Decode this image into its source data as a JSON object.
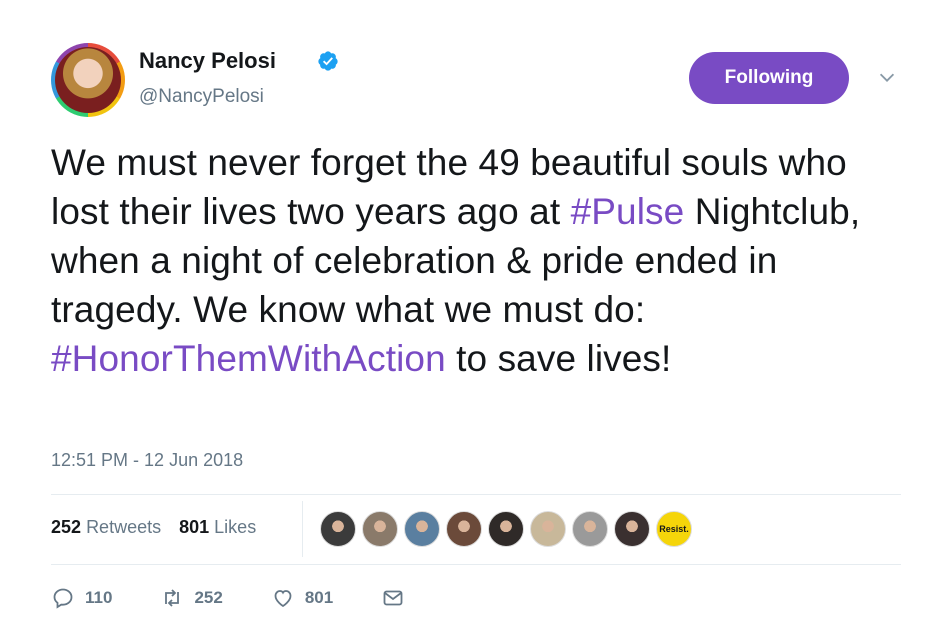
{
  "author": {
    "name": "Nancy Pelosi",
    "handle": "@NancyPelosi",
    "verified": true
  },
  "follow_button": {
    "label": "Following",
    "color": "#794bc4"
  },
  "tweet": {
    "segments": [
      {
        "text": "We must never forget the 49 beautiful souls who lost their lives two years ago at ",
        "tag": false
      },
      {
        "text": "#Pulse",
        "tag": true
      },
      {
        "text": " Nightclub, when a night of celebration & pride ended in tragedy. We know what we must do: ",
        "tag": false
      },
      {
        "text": "#HonorThemWithAction",
        "tag": true
      },
      {
        "text": " to save lives!",
        "tag": false
      }
    ],
    "timestamp": "12:51 PM - 12 Jun 2018"
  },
  "stats": {
    "retweets_count": "252",
    "retweets_label": "Retweets",
    "likes_count": "801",
    "likes_label": "Likes"
  },
  "likers": {
    "avatar_colors": [
      "#3b3b3b",
      "#8a7a6a",
      "#5a7fa0",
      "#6b4a3a",
      "#2f2a28",
      "#c8b89a",
      "#9a9a9a",
      "#3a3030"
    ],
    "resist_label": "Resist."
  },
  "actions": {
    "reply_count": "110",
    "retweet_count": "252",
    "like_count": "801"
  },
  "colors": {
    "accent": "#794bc4",
    "muted": "#657786",
    "divider": "#e6ecf0"
  }
}
